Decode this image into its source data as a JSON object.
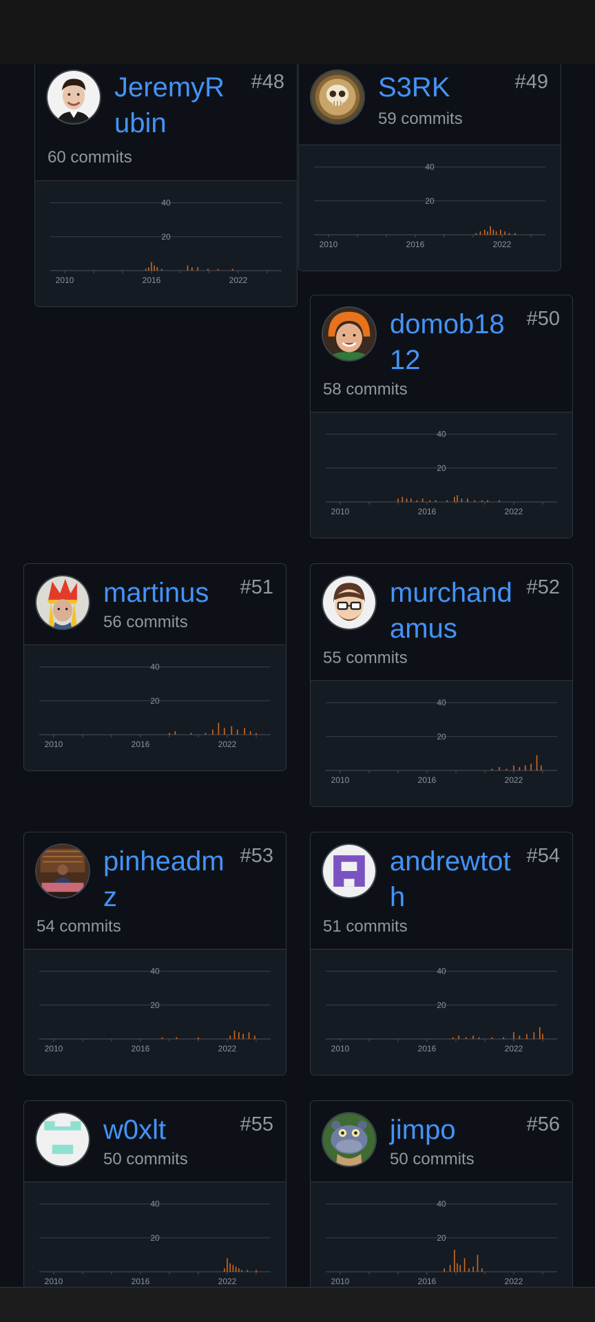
{
  "accent": "#4493f8",
  "bar_color": "#d2691e",
  "contributors": [
    {
      "rank": "#48",
      "name": "JeremyRubin",
      "commits_label": "60 commits",
      "avatar": "portrait-avatar",
      "chart_data": {
        "type": "bar",
        "y_ticks": [
          "40",
          "20"
        ],
        "x_ticks": [
          "2010",
          "2016",
          "2022"
        ],
        "ylim": [
          0,
          50
        ],
        "activity": [
          [
            2015.6,
            1
          ],
          [
            2015.8,
            2
          ],
          [
            2016.0,
            5
          ],
          [
            2016.2,
            3
          ],
          [
            2016.4,
            2
          ],
          [
            2016.7,
            1
          ],
          [
            2018.5,
            3
          ],
          [
            2018.8,
            2
          ],
          [
            2019.2,
            2
          ],
          [
            2019.9,
            1
          ],
          [
            2020.6,
            1
          ],
          [
            2021.6,
            1
          ]
        ]
      }
    },
    {
      "rank": "#49",
      "name": "S3RK",
      "commits_label": "59 commits",
      "avatar": "coffee-skull-avatar",
      "chart_data": {
        "type": "bar",
        "y_ticks": [
          "40",
          "20"
        ],
        "x_ticks": [
          "2010",
          "2016",
          "2022"
        ],
        "ylim": [
          0,
          50
        ],
        "activity": [
          [
            2020.2,
            1
          ],
          [
            2020.5,
            2
          ],
          [
            2020.8,
            3
          ],
          [
            2021.0,
            2
          ],
          [
            2021.2,
            5
          ],
          [
            2021.4,
            3
          ],
          [
            2021.6,
            2
          ],
          [
            2021.9,
            3
          ],
          [
            2022.2,
            2
          ],
          [
            2022.5,
            1
          ],
          [
            2022.9,
            1
          ]
        ]
      }
    },
    {
      "rank": "#50",
      "name": "domob1812",
      "commits_label": "58 commits",
      "avatar": "orange-hat-avatar",
      "chart_data": {
        "type": "bar",
        "y_ticks": [
          "40",
          "20"
        ],
        "x_ticks": [
          "2010",
          "2016",
          "2022"
        ],
        "ylim": [
          0,
          50
        ],
        "activity": [
          [
            2014.0,
            2
          ],
          [
            2014.3,
            3
          ],
          [
            2014.6,
            2
          ],
          [
            2014.9,
            2
          ],
          [
            2015.3,
            1
          ],
          [
            2015.7,
            2
          ],
          [
            2016.2,
            1
          ],
          [
            2016.6,
            1
          ],
          [
            2017.4,
            1
          ],
          [
            2017.9,
            3
          ],
          [
            2018.1,
            4
          ],
          [
            2018.4,
            2
          ],
          [
            2018.8,
            2
          ],
          [
            2019.3,
            1
          ],
          [
            2019.8,
            1
          ],
          [
            2020.2,
            1
          ],
          [
            2021.0,
            1
          ]
        ]
      }
    },
    {
      "rank": "#51",
      "name": "martinus",
      "commits_label": "56 commits",
      "avatar": "clown-hat-avatar",
      "chart_data": {
        "type": "bar",
        "y_ticks": [
          "40",
          "20"
        ],
        "x_ticks": [
          "2010",
          "2016",
          "2022"
        ],
        "ylim": [
          0,
          50
        ],
        "activity": [
          [
            2018.0,
            1
          ],
          [
            2018.4,
            2
          ],
          [
            2019.5,
            1
          ],
          [
            2020.5,
            1
          ],
          [
            2021.0,
            3
          ],
          [
            2021.4,
            7
          ],
          [
            2021.8,
            4
          ],
          [
            2022.3,
            5
          ],
          [
            2022.7,
            3
          ],
          [
            2023.2,
            4
          ],
          [
            2023.6,
            2
          ],
          [
            2024.0,
            1
          ]
        ]
      }
    },
    {
      "rank": "#52",
      "name": "murchandamus",
      "commits_label": "55 commits",
      "avatar": "glasses-avatar",
      "chart_data": {
        "type": "bar",
        "y_ticks": [
          "40",
          "20"
        ],
        "x_ticks": [
          "2010",
          "2016",
          "2022"
        ],
        "ylim": [
          0,
          50
        ],
        "activity": [
          [
            2020.5,
            1
          ],
          [
            2021.0,
            2
          ],
          [
            2021.5,
            1
          ],
          [
            2022.0,
            3
          ],
          [
            2022.4,
            2
          ],
          [
            2022.8,
            3
          ],
          [
            2023.2,
            4
          ],
          [
            2023.6,
            9
          ],
          [
            2023.9,
            3
          ]
        ]
      }
    },
    {
      "rank": "#53",
      "name": "pinheadmz",
      "commits_label": "54 commits",
      "avatar": "presenter-avatar",
      "chart_data": {
        "type": "bar",
        "y_ticks": [
          "40",
          "20"
        ],
        "x_ticks": [
          "2010",
          "2016",
          "2022"
        ],
        "ylim": [
          0,
          50
        ],
        "activity": [
          [
            2017.5,
            1
          ],
          [
            2018.5,
            1
          ],
          [
            2020.0,
            1
          ],
          [
            2022.2,
            2
          ],
          [
            2022.5,
            5
          ],
          [
            2022.8,
            4
          ],
          [
            2023.1,
            3
          ],
          [
            2023.5,
            4
          ],
          [
            2023.9,
            2
          ]
        ]
      }
    },
    {
      "rank": "#54",
      "name": "andrewtoth",
      "commits_label": "51 commits",
      "avatar": "purple-identicon-avatar",
      "chart_data": {
        "type": "bar",
        "y_ticks": [
          "40",
          "20"
        ],
        "x_ticks": [
          "2010",
          "2016",
          "2022"
        ],
        "ylim": [
          0,
          50
        ],
        "activity": [
          [
            2017.8,
            1
          ],
          [
            2018.2,
            2
          ],
          [
            2018.7,
            1
          ],
          [
            2019.2,
            2
          ],
          [
            2019.6,
            1
          ],
          [
            2020.5,
            1
          ],
          [
            2021.3,
            1
          ],
          [
            2022.0,
            4
          ],
          [
            2022.4,
            2
          ],
          [
            2022.9,
            3
          ],
          [
            2023.4,
            4
          ],
          [
            2023.8,
            7
          ],
          [
            2024.0,
            3
          ]
        ]
      }
    },
    {
      "rank": "#55",
      "name": "w0xlt",
      "commits_label": "50 commits",
      "avatar": "teal-identicon-avatar",
      "chart_data": {
        "type": "bar",
        "y_ticks": [
          "40",
          "20"
        ],
        "x_ticks": [
          "2010",
          "2016",
          "2022"
        ],
        "ylim": [
          0,
          50
        ],
        "activity": [
          [
            2021.8,
            2
          ],
          [
            2022.0,
            8
          ],
          [
            2022.2,
            5
          ],
          [
            2022.4,
            4
          ],
          [
            2022.6,
            3
          ],
          [
            2022.8,
            2
          ],
          [
            2023.0,
            1
          ],
          [
            2023.4,
            1
          ],
          [
            2024.0,
            1
          ]
        ]
      }
    },
    {
      "rank": "#56",
      "name": "jimpo",
      "commits_label": "50 commits",
      "avatar": "hippo-avatar",
      "chart_data": {
        "type": "bar",
        "y_ticks": [
          "40",
          "20"
        ],
        "x_ticks": [
          "2010",
          "2016",
          "2022"
        ],
        "ylim": [
          0,
          50
        ],
        "activity": [
          [
            2017.2,
            2
          ],
          [
            2017.6,
            4
          ],
          [
            2017.9,
            13
          ],
          [
            2018.1,
            5
          ],
          [
            2018.3,
            4
          ],
          [
            2018.6,
            8
          ],
          [
            2018.9,
            2
          ],
          [
            2019.2,
            3
          ],
          [
            2019.5,
            10
          ],
          [
            2019.8,
            2
          ]
        ]
      }
    }
  ]
}
